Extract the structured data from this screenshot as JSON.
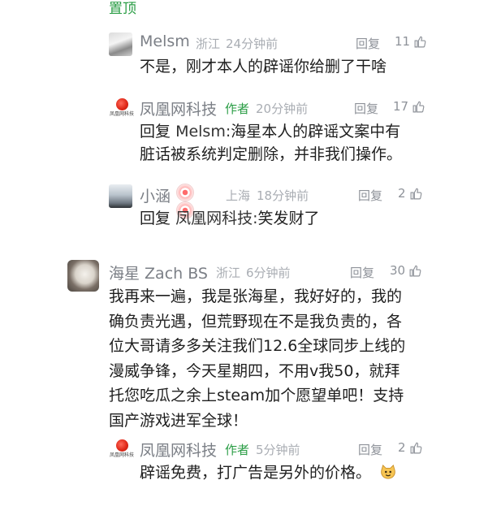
{
  "pinned_label": "置顶",
  "reply_label": "回复",
  "comments": [
    {
      "name": "Melsm",
      "location": "浙江",
      "time": "24分钟前",
      "likes": "11",
      "text": "不是，刚才本人的辟谣你给删了干啥"
    },
    {
      "name": "凤凰网科技",
      "author_tag": "作者",
      "time": "20分钟前",
      "likes": "17",
      "logo_sub": "凤凰网科技",
      "reply_prefix": "回复",
      "reply_to": "Melsm:",
      "line1": "海星本人的辟谣文案中有",
      "line2": "脏话被系统判定删除，并非我们操作。"
    },
    {
      "name": "小涵",
      "location": "上海",
      "time": "18分钟前",
      "likes": "2",
      "reply_prefix": "回复",
      "reply_to": "凤凰网科技:",
      "line1": "笑发财了"
    },
    {
      "name": "海星 Zach BS",
      "location": "浙江",
      "time": "6分钟前",
      "likes": "30",
      "lines": [
        "我再来一遍，我是张海星，我好好的，我的",
        "确负责光遇，但荒野现在不是我负责的，各",
        "位大哥请多多关注我们12.6全球同步上线的",
        "漫威争锋，今天星期四，不用v我50，就拜",
        "托您吃瓜之余上steam加个愿望单吧！支持",
        "国产游戏进军全球！"
      ]
    },
    {
      "name": "凤凰网科技",
      "author_tag": "作者",
      "time": "5分钟前",
      "likes": "2",
      "logo_sub": "凤凰网科技",
      "text": "辟谣免费，打广告是另外的价格。"
    }
  ],
  "colors": {
    "green": "#2a9d45",
    "name_gray": "#7b7f86",
    "meta_gray": "#a9adb3",
    "text": "#1f1f1f"
  },
  "icons": {
    "like": "thumbs-up-icon",
    "badge": "user-badge-icon",
    "emoji": "cat-emoji-icon"
  }
}
